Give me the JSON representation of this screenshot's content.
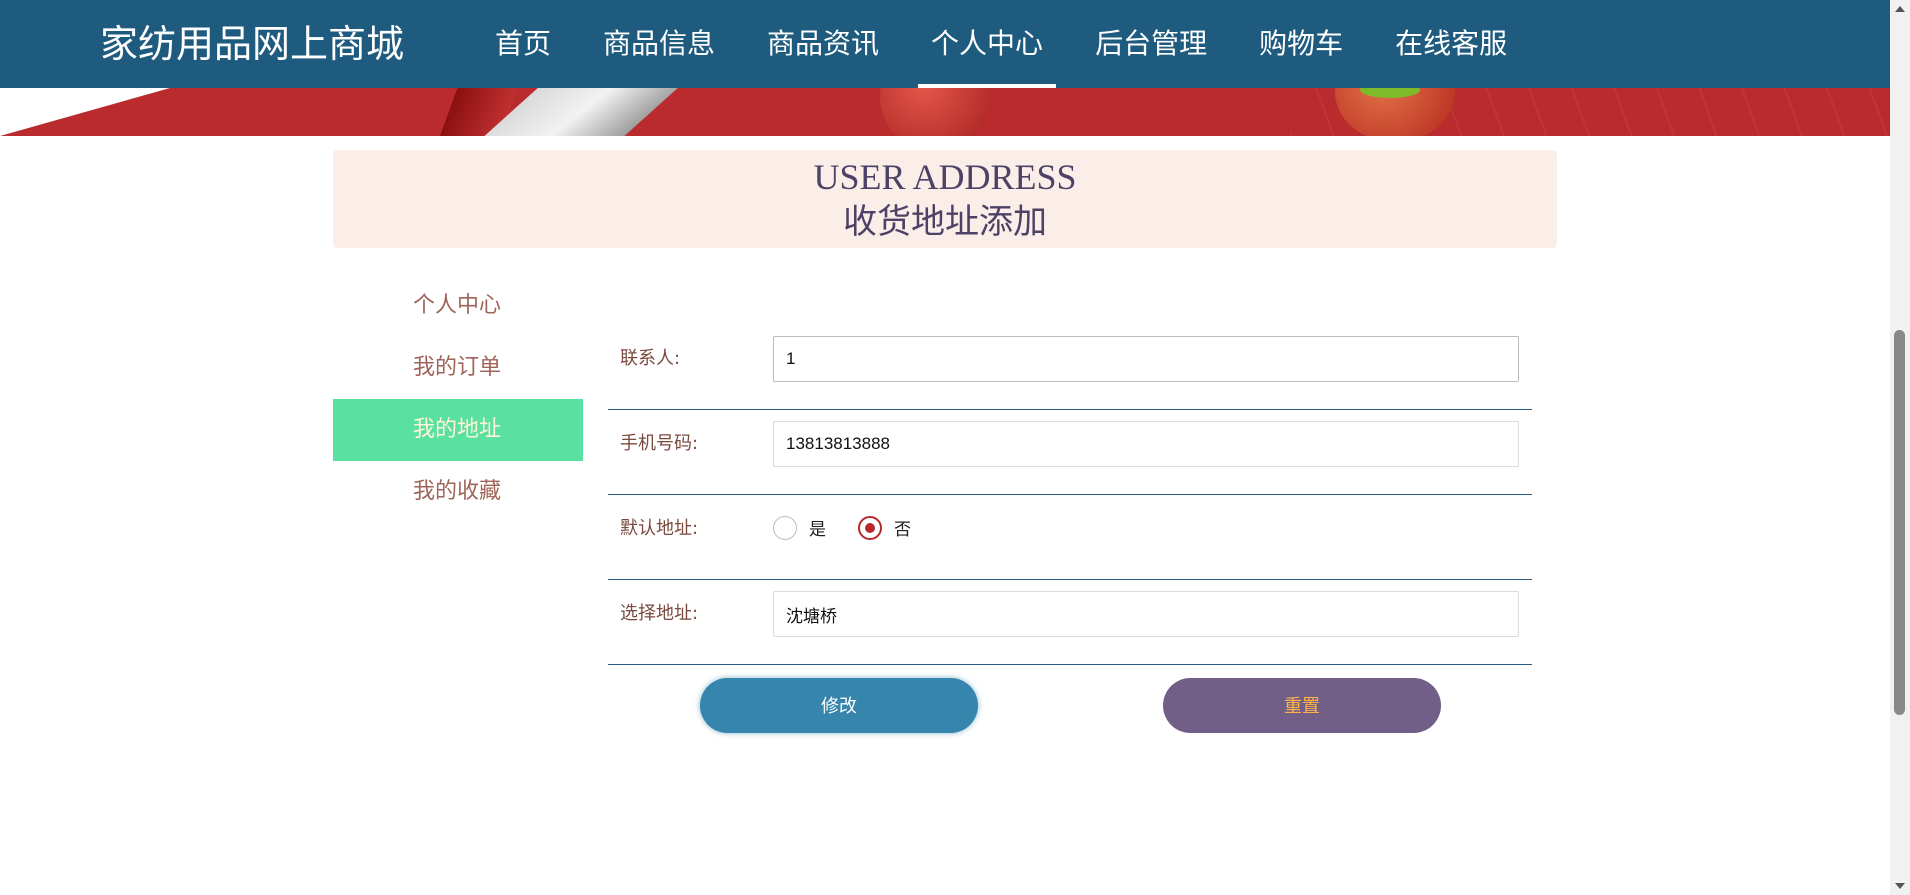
{
  "header": {
    "brand": "家纺用品网上商城",
    "nav": [
      {
        "label": "首页"
      },
      {
        "label": "商品信息"
      },
      {
        "label": "商品资讯"
      },
      {
        "label": "个人中心",
        "active": true
      },
      {
        "label": "后台管理"
      },
      {
        "label": "购物车"
      },
      {
        "label": "在线客服"
      }
    ]
  },
  "title": {
    "en": "USER ADDRESS",
    "cn": "收货地址添加"
  },
  "sidebar": {
    "items": [
      {
        "label": "个人中心"
      },
      {
        "label": "我的订单"
      },
      {
        "label": "我的地址",
        "active": true
      },
      {
        "label": "我的收藏"
      }
    ]
  },
  "form": {
    "contact": {
      "label": "联系人:",
      "value": "1"
    },
    "phone": {
      "label": "手机号码:",
      "value": "13813813888"
    },
    "default_address": {
      "label": "默认地址:",
      "options": [
        {
          "label": "是",
          "checked": false
        },
        {
          "label": "否",
          "checked": true
        }
      ]
    },
    "address": {
      "label": "选择地址:",
      "value": "沈塘桥"
    }
  },
  "buttons": {
    "submit": "修改",
    "reset": "重置"
  },
  "colors": {
    "nav_bg": "#1e5b7e",
    "title_bg": "#fbeee8",
    "active_menu": "#5ae0a0",
    "submit_btn": "#3585ac",
    "reset_btn": "#715f87",
    "radio_checked": "#b8292a"
  }
}
